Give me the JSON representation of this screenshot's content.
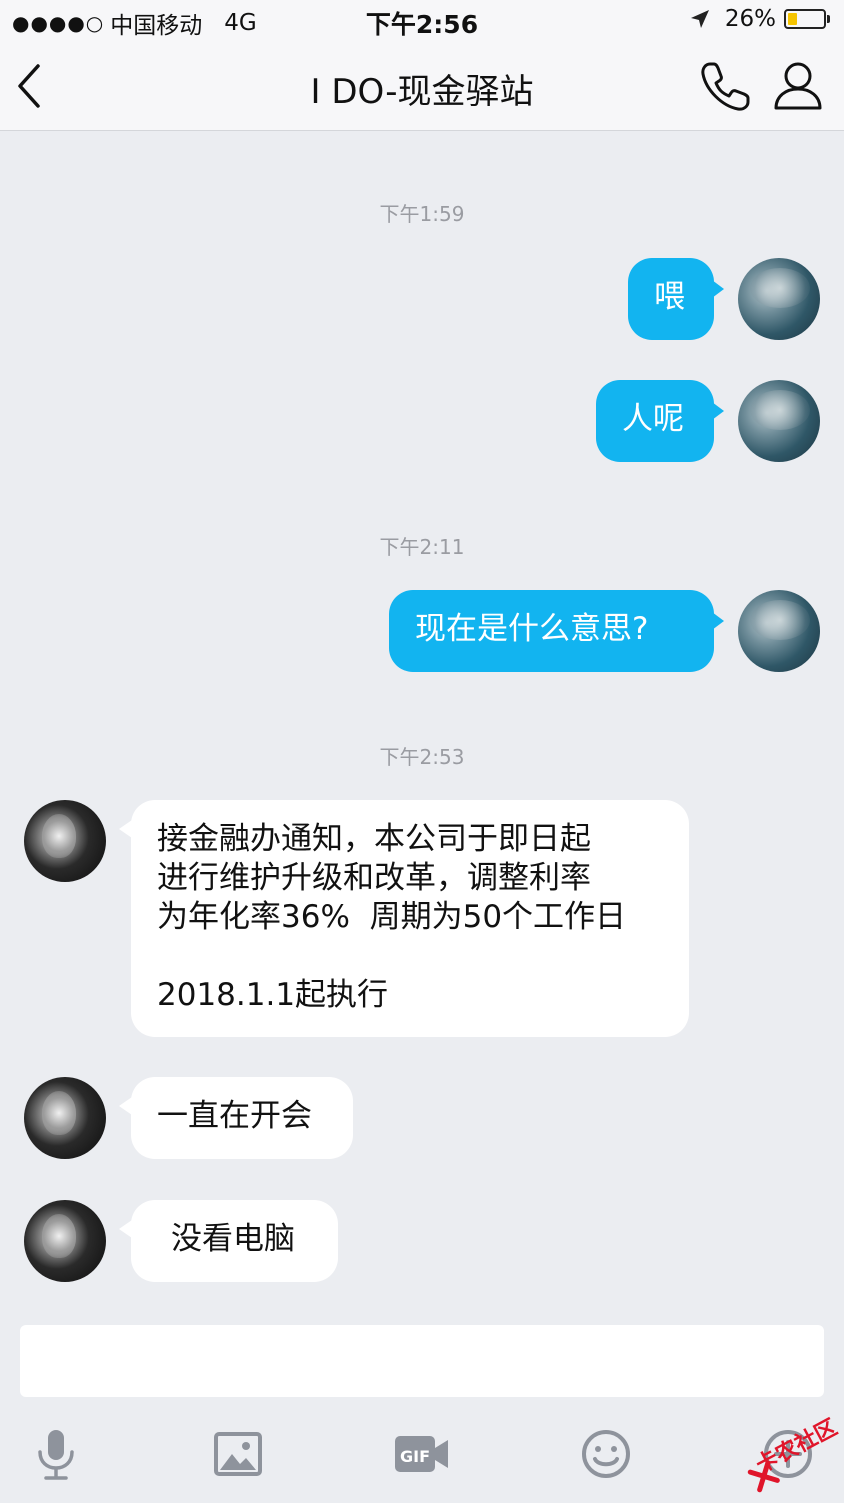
{
  "status_bar": {
    "signal": "●●●●○",
    "carrier": "中国移动",
    "network": "4G",
    "time": "下午2:56",
    "battery": "26%",
    "battery_level": 0.26
  },
  "nav": {
    "title": "I DO-现金驿站"
  },
  "messages": {
    "t1": "下午1:59",
    "m1": "喂",
    "m2": "人呢",
    "t2": "下午2:11",
    "m3": "现在是什么意思?",
    "t3": "下午2:53",
    "m4_lines": [
      "接金融办通知，本公司于即日起",
      "进行维护升级和改革，调整利率",
      "为年化率36%  周期为50个工作日",
      "",
      "2018.1.1起执行"
    ],
    "m5": "一直在开会",
    "m6": "没看电脑"
  },
  "input": {
    "value": ""
  },
  "toolbar": {
    "icons": [
      "microphone-icon",
      "image-icon",
      "gif-icon",
      "emoji-icon",
      "more-icon"
    ]
  },
  "watermark": {
    "text": "卡农社区"
  },
  "colors": {
    "outgoing_bubble": "#12b4f0",
    "incoming_bubble": "#ffffff",
    "background": "#ebedf1",
    "battery": "#f5c400"
  }
}
